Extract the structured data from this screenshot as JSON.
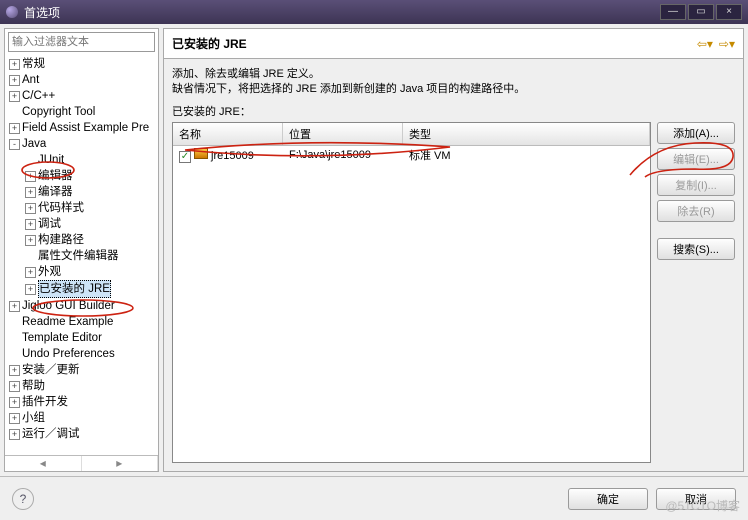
{
  "window": {
    "title": "首选项",
    "min": "—",
    "max": "▭",
    "close": "×"
  },
  "sidebar": {
    "filter_placeholder": "输入过滤器文本",
    "items": [
      {
        "d": 0,
        "e": "+",
        "l": "常规"
      },
      {
        "d": 0,
        "e": "+",
        "l": "Ant"
      },
      {
        "d": 0,
        "e": "+",
        "l": "C/C++"
      },
      {
        "d": 0,
        "e": "",
        "l": "Copyright Tool"
      },
      {
        "d": 0,
        "e": "+",
        "l": "Field Assist Example Pre"
      },
      {
        "d": 0,
        "e": "-",
        "l": "Java"
      },
      {
        "d": 1,
        "e": "",
        "l": "JUnit"
      },
      {
        "d": 1,
        "e": "+",
        "l": "编辑器"
      },
      {
        "d": 1,
        "e": "+",
        "l": "编译器"
      },
      {
        "d": 1,
        "e": "+",
        "l": "代码样式"
      },
      {
        "d": 1,
        "e": "+",
        "l": "调试"
      },
      {
        "d": 1,
        "e": "+",
        "l": "构建路径"
      },
      {
        "d": 1,
        "e": "",
        "l": "属性文件编辑器"
      },
      {
        "d": 1,
        "e": "+",
        "l": "外观"
      },
      {
        "d": 1,
        "e": "+",
        "l": "已安装的 JRE",
        "sel": true
      },
      {
        "d": 0,
        "e": "+",
        "l": "Jigloo GUI Builder"
      },
      {
        "d": 0,
        "e": "",
        "l": "Readme Example"
      },
      {
        "d": 0,
        "e": "",
        "l": "Template Editor"
      },
      {
        "d": 0,
        "e": "",
        "l": "Undo Preferences"
      },
      {
        "d": 0,
        "e": "+",
        "l": "安装／更新"
      },
      {
        "d": 0,
        "e": "+",
        "l": "帮助"
      },
      {
        "d": 0,
        "e": "+",
        "l": "插件开发"
      },
      {
        "d": 0,
        "e": "+",
        "l": "小组"
      },
      {
        "d": 0,
        "e": "+",
        "l": "运行／调试"
      }
    ]
  },
  "main": {
    "title": "已安装的 JRE",
    "desc1": "添加、除去或编辑 JRE 定义。",
    "desc2": "缺省情况下，将把选择的 JRE 添加到新创建的 Java 项目的构建路径中。",
    "table_label": "已安装的 JRE：",
    "cols": {
      "name": "名称",
      "loc": "位置",
      "type": "类型"
    },
    "rows": [
      {
        "checked": true,
        "name": "jre15009",
        "loc": "F:\\Java\\jre15009",
        "type": "标准 VM"
      }
    ],
    "buttons": {
      "add": "添加(A)...",
      "edit": "编辑(E)...",
      "copy": "复制(I)...",
      "remove": "除去(R)",
      "search": "搜索(S)..."
    }
  },
  "footer": {
    "help": "?",
    "ok": "确定",
    "cancel": "取消"
  },
  "watermark": "@51CTO博客"
}
